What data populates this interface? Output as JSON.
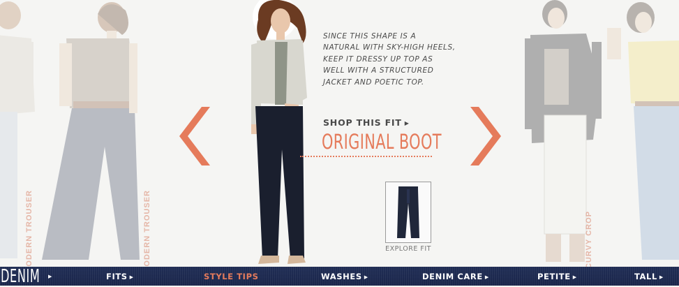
{
  "product": {
    "description": "Since this shape is a natural with sky-high heels, keep it dressy up top as well with a structured jacket and poetic top.",
    "shop_label": "SHOP THIS FIT",
    "fit_name": "ORIGINAL BOOT",
    "explore_label": "EXPLORE FIT"
  },
  "side_fits": {
    "left_1": "MODERN TROUSER",
    "left_2": "MODERN TROUSER",
    "right_1": "CURVY CROP"
  },
  "navigation": {
    "logo": "DENIM",
    "items": [
      {
        "label": "FITS"
      },
      {
        "label": "STYLE TIPS"
      },
      {
        "label": "WASHES"
      },
      {
        "label": "DENIM CARE"
      },
      {
        "label": "PETITE"
      },
      {
        "label": "TALL"
      }
    ],
    "active_item": "STYLE TIPS"
  },
  "colors": {
    "accent": "#e57b5b",
    "nav_background": "#1f2b54",
    "text": "#4a4a4a"
  },
  "icons": {
    "prev": "chevron-left-icon",
    "next": "chevron-right-icon",
    "caret": "caret-right-icon"
  }
}
